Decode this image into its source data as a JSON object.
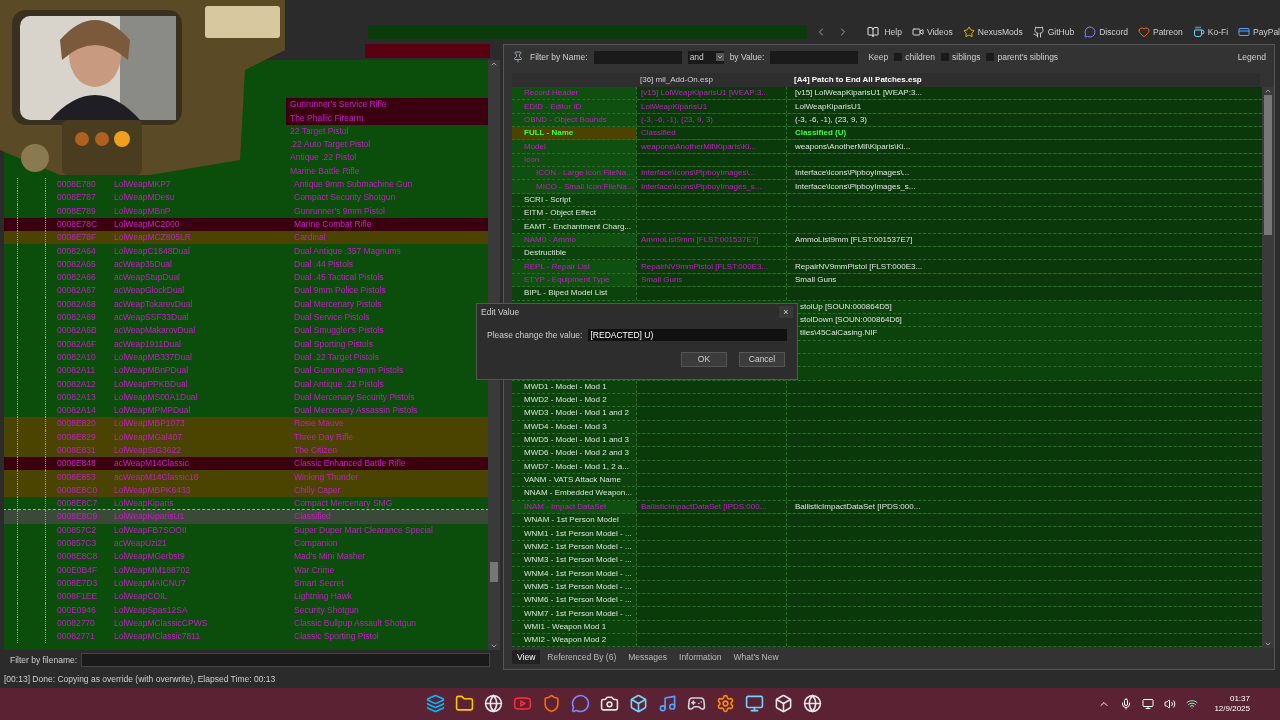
{
  "toolbar": {
    "links": [
      {
        "label": "Help",
        "kind": "book"
      },
      {
        "label": "Videos",
        "kind": "video"
      },
      {
        "label": "NexusMods",
        "kind": "nexus"
      },
      {
        "label": "GitHub",
        "kind": "github"
      },
      {
        "label": "Discord",
        "kind": "discord"
      },
      {
        "label": "Patreon",
        "kind": "patreon"
      },
      {
        "label": "Ko-Fi",
        "kind": "kofi"
      },
      {
        "label": "PayPal",
        "kind": "paypal"
      }
    ]
  },
  "left_pane": {
    "rows": [
      {
        "name": "Gunrunner's Service Rifle",
        "color": "#3a0010",
        "selected": false
      },
      {
        "name": "The Phallic Firearm",
        "color": "#3a0010",
        "selected": false
      },
      {
        "name": "22 Target Pistol",
        "color": "#0b4d0b",
        "selected": false
      },
      {
        "name": ".22 Auto Target Pistol",
        "color": "#0b4d0b",
        "selected": false
      },
      {
        "name": "Antique .22 Pistol",
        "color": "#0b4d0b",
        "selected": false
      },
      {
        "name": "Marine Battle Rifle",
        "color": "#0b4d0b",
        "selected": false
      },
      {
        "form_id": "0008E780",
        "editor_id": "LolWeapMKP7",
        "name": "Antique 9mm Submachine Gun",
        "color": "#0b4d0b",
        "selected": false
      },
      {
        "form_id": "0008E787",
        "editor_id": "LolWeapMDesu",
        "name": "Compact Security Shotgun",
        "color": "#0b4d0b",
        "selected": false
      },
      {
        "form_id": "0008E789",
        "editor_id": "LolWeapMBnP",
        "name": "Gunrunner's 9mm Pistol",
        "color": "#0b4d0b",
        "selected": false
      },
      {
        "form_id": "0008E78C",
        "editor_id": "LolWeapMC2000",
        "name": "Marine Combat Rifle",
        "color": "#3a0010",
        "selected": false
      },
      {
        "form_id": "0008E78F",
        "editor_id": "LolWeapMCZ805LR",
        "name": "Cardinal",
        "color": "#4a4400",
        "selected": false
      },
      {
        "form_id": "00082A64",
        "editor_id": "LolWeapC1848Dual",
        "name": "Dual Antique .357 Magnums",
        "color": "#0b4d0b",
        "selected": false
      },
      {
        "form_id": "00082A65",
        "editor_id": "acWeap35Dual",
        "name": "Dual .44 Pistols",
        "color": "#0b4d0b",
        "selected": false
      },
      {
        "form_id": "00082A66",
        "editor_id": "acWeapStupDual",
        "name": "Dual .45 Tactical Pistols",
        "color": "#0b4d0b",
        "selected": false
      },
      {
        "form_id": "00082A67",
        "editor_id": "acWeapGlockDual",
        "name": "Dual 9mm Police Pistols",
        "color": "#0b4d0b",
        "selected": false
      },
      {
        "form_id": "00082A68",
        "editor_id": "acWeapTokarevDual",
        "name": "Dual Mercenary Pistols",
        "color": "#0b4d0b",
        "selected": false
      },
      {
        "form_id": "00082A69",
        "editor_id": "acWeapSSF33Dual",
        "name": "Dual Service Pistols",
        "color": "#0b4d0b",
        "selected": false
      },
      {
        "form_id": "00082A6B",
        "editor_id": "acWeapMakarovDual",
        "name": "Dual Smuggler's Pistols",
        "color": "#0b4d0b",
        "selected": false
      },
      {
        "form_id": "00082A6F",
        "editor_id": "acWeap1911Dual",
        "name": "Dual Sporting Pistols",
        "color": "#0b4d0b",
        "selected": false
      },
      {
        "form_id": "00082A10",
        "editor_id": "LolWeapMB337Dual",
        "name": "Dual .22 Target Pistols",
        "color": "#0b4d0b",
        "selected": false
      },
      {
        "form_id": "00082A11",
        "editor_id": "LolWeapMBnPDual",
        "name": "Dual Gunrunner 9mm Pistols",
        "color": "#0b4d0b",
        "selected": false
      },
      {
        "form_id": "00082A12",
        "editor_id": "LolWeapPPKBDual",
        "name": "Dual Antique .22 Pistols",
        "color": "#0b4d0b",
        "selected": false
      },
      {
        "form_id": "00082A13",
        "editor_id": "LolWeapMS00A1Dual",
        "name": "Dual Mercenary Security Pistols",
        "color": "#0b4d0b",
        "selected": false
      },
      {
        "form_id": "00082A14",
        "editor_id": "LolWeapMPMPDual",
        "name": "Dual Mercenary Assassin Pistols",
        "color": "#0b4d0b",
        "selected": false
      },
      {
        "form_id": "0008E820",
        "editor_id": "LolWeapMBP1073",
        "name": "Rosie Mauve",
        "color": "#4a4400",
        "selected": false
      },
      {
        "form_id": "0008E829",
        "editor_id": "LolWeapMGal407",
        "name": "Three Day Rifle",
        "color": "#4a4400",
        "selected": false
      },
      {
        "form_id": "0008E831",
        "editor_id": "LolWeapSIG3622",
        "name": "The Citizen",
        "color": "#4a4400",
        "selected": false
      },
      {
        "form_id": "0008E848",
        "editor_id": "acWeapM14Classic",
        "name": "Classic Enhanced Battle Rifle",
        "color": "#3a0010",
        "selected": false
      },
      {
        "form_id": "0008E853",
        "editor_id": "acWeapM14Classic18",
        "name": "Winking Thunder",
        "color": "#4a4400",
        "selected": false
      },
      {
        "form_id": "0008E8C0",
        "editor_id": "LolWeapMBPK6433",
        "name": "Chilly Caper",
        "color": "#4a4400",
        "selected": false
      },
      {
        "form_id": "0008E8C7",
        "editor_id": "LolWeapKiparis",
        "name": "Compact Mercenary SMG",
        "color": "#0b4d0b",
        "selected": false
      },
      {
        "form_id": "0008E8C9",
        "editor_id": "LolWeapKiparisU1",
        "name": "Classified",
        "color": "#3b4a38",
        "selected": true
      },
      {
        "form_id": "000857C2",
        "editor_id": "LolWeapFB7SOOII",
        "name": "Super Duper Mart Clearance Special",
        "color": "#0b4d0b",
        "selected": false
      },
      {
        "form_id": "000857C3",
        "editor_id": "acWeapUzi21",
        "name": "Companion",
        "color": "#0b4d0b",
        "selected": false
      },
      {
        "form_id": "0008E8C8",
        "editor_id": "LolWeapMGerbst9",
        "name": "Mad's Mini Masher",
        "color": "#0b4d0b",
        "selected": false
      },
      {
        "form_id": "000E0B4F",
        "editor_id": "LolWeapMM188702",
        "name": "War Crime",
        "color": "#0b4d0b",
        "selected": false
      },
      {
        "form_id": "0008E7D3",
        "editor_id": "LolWeapMAICNU7",
        "name": "Smart Secret",
        "color": "#0b4d0b",
        "selected": false
      },
      {
        "form_id": "0008F1EE",
        "editor_id": "LolWeapCOIL",
        "name": "Lightning Hawk",
        "color": "#0b4d0b",
        "selected": false
      },
      {
        "form_id": "000E0946",
        "editor_id": "LolWeapSpas12SA",
        "name": "Security Shotgun",
        "color": "#0b4d0b",
        "selected": false
      },
      {
        "form_id": "00082770",
        "editor_id": "LolWeapMClassicCPWS",
        "name": "Classic Bullpup Assault Shotgun",
        "color": "#0b4d0b",
        "selected": false
      },
      {
        "form_id": "00082771",
        "editor_id": "LolWeapMClassic7811",
        "name": "Classic Sporting Pistol",
        "color": "#0b4d0b",
        "selected": false
      }
    ],
    "filter": {
      "label": "Filter by filename:"
    }
  },
  "right_pane": {
    "filter": {
      "name_label": "Filter by Name:",
      "operator": "and",
      "value_label": "by Value:",
      "keep_label": "Keep",
      "options": [
        {
          "label": "children",
          "checked": false
        },
        {
          "label": "siblings",
          "checked": false
        },
        {
          "label": "parent's siblings",
          "checked": false
        }
      ],
      "legend": "Legend"
    },
    "columns": [
      "[36] mil_Add-On.esp",
      "[A4] Patch to End All Patches.esp"
    ],
    "rows_above": [
      {
        "label": "Record Header",
        "values": [
          "[v15] LolWeapKiparisU1 [WEAP:3...",
          "[v15] LolWeapKiparisU1 [WEAP:3..."
        ],
        "conflict": true,
        "highlight": false
      },
      {
        "label": "EDID - Editor ID",
        "values": [
          "LolWeapKiparisU1",
          "LolWeapKiparisU1"
        ],
        "conflict": true,
        "highlight": false
      },
      {
        "label": "OBND - Object Bounds",
        "values": [
          "(-3, -6, -1), (23, 9, 3)",
          "(-3, -6, -1), (23, 9, 3)"
        ],
        "conflict": true,
        "highlight": false
      },
      {
        "label": "FULL - Name",
        "values": [
          "Classified",
          "Classified (U)"
        ],
        "conflict": true,
        "highlight": true
      },
      {
        "label": "Model",
        "values": [
          "weapons\\AnotherMil\\Kiparis\\Ki...",
          "weapons\\AnotherMil\\Kiparis\\Ki..."
        ],
        "conflict": true,
        "highlight": false
      },
      {
        "label": "Icon",
        "conflict": true,
        "highlight": false,
        "children": [
          {
            "label": "ICON - Large Icon FileNa...",
            "values": [
              "Interface\\Icons\\PipboyImages\\...",
              "Interface\\Icons\\PipboyImages\\..."
            ],
            "conflict": true,
            "highlight": false
          },
          {
            "label": "MICO - Small Icon FileNa...",
            "values": [
              "Interface\\Icons\\PipboyImages_s...",
              "Interface\\Icons\\PipboyImages_s..."
            ],
            "conflict": true,
            "highlight": false
          }
        ]
      },
      {
        "label": "SCRI - Script",
        "conflict": false,
        "highlight": false
      },
      {
        "label": "EITM - Object Effect",
        "conflict": false,
        "highlight": false
      },
      {
        "label": "EAMT - Enchantment Charg...",
        "conflict": false,
        "highlight": false
      },
      {
        "label": "NAM0 - Ammo",
        "values": [
          "AmmoList9mm [FLST:001537E7]",
          "AmmoList9mm [FLST:001537E7]"
        ],
        "conflict": true,
        "highlight": false
      },
      {
        "label": "Destructible",
        "conflict": false,
        "highlight": false
      },
      {
        "label": "REPL - Repair List",
        "values": [
          "RepairNV9mmPistol [FLST:000E3...",
          "RepairNV9mmPistol [FLST:000E3..."
        ],
        "conflict": true,
        "highlight": false
      },
      {
        "label": "ETYP - Equipment Type",
        "values": [
          "Small Guns",
          "Small Guns"
        ],
        "conflict": true,
        "highlight": false
      },
      {
        "label": "BIPL - Biped Model List",
        "conflict": false,
        "highlight": false
      }
    ],
    "partial_values": [
      "stolUp [SOUN:000864D5]",
      "stolDown [SOUN:000864D6]",
      "tiles\\45CalCasing.NIF"
    ],
    "rows_below": [
      {
        "label": "MWD1 - Model - Mod 1",
        "conflict": false,
        "highlight": false
      },
      {
        "label": "MWD2 - Model - Mod 2",
        "conflict": false,
        "highlight": false
      },
      {
        "label": "MWD3 - Model - Mod 1 and 2",
        "conflict": false,
        "highlight": false
      },
      {
        "label": "MWD4 - Model - Mod 3",
        "conflict": false,
        "highlight": false
      },
      {
        "label": "MWD5 - Model - Mod 1 and 3",
        "conflict": false,
        "highlight": false
      },
      {
        "label": "MWD6 - Model - Mod 2 and 3",
        "conflict": false,
        "highlight": false
      },
      {
        "label": "MWD7 - Model - Mod 1, 2 a...",
        "conflict": false,
        "highlight": false
      },
      {
        "label": "VANM - VATS Attack Name",
        "conflict": false,
        "highlight": false
      },
      {
        "label": "NNAM - Embedded Weapon...",
        "conflict": false,
        "highlight": false
      },
      {
        "label": "INAM - Impact DataSet",
        "values": [
          "BallisticImpactDataSet [IPDS:000...",
          "BallisticImpactDataSet [IPDS:000..."
        ],
        "conflict": true,
        "highlight": false
      },
      {
        "label": "WNAM - 1st Person Model",
        "conflict": false,
        "highlight": false
      },
      {
        "label": "WNM1 - 1st Person Model - ...",
        "conflict": false,
        "highlight": false
      },
      {
        "label": "WNM2 - 1st Person Model - ...",
        "conflict": false,
        "highlight": false
      },
      {
        "label": "WNM3 - 1st Person Model - ...",
        "conflict": false,
        "highlight": false
      },
      {
        "label": "WNM4 - 1st Person Model - ...",
        "conflict": false,
        "highlight": false
      },
      {
        "label": "WNM5 - 1st Person Model - ...",
        "conflict": false,
        "highlight": false
      },
      {
        "label": "WNM6 - 1st Person Model - ...",
        "conflict": false,
        "highlight": false
      },
      {
        "label": "WNM7 - 1st Person Model - ...",
        "conflict": false,
        "highlight": false
      },
      {
        "label": "WMI1 - Weapon Mod 1",
        "conflict": false,
        "highlight": false
      },
      {
        "label": "WMI2 - Weapon Mod 2",
        "conflict": false,
        "highlight": false
      }
    ],
    "tabs": [
      {
        "label": "View",
        "selected": true
      },
      {
        "label": "Referenced By (6)",
        "selected": false
      },
      {
        "label": "Messages",
        "selected": false
      },
      {
        "label": "Information",
        "selected": false
      },
      {
        "label": "What's New",
        "selected": false
      }
    ]
  },
  "dialog": {
    "title": "Edit Value",
    "close": "×",
    "prompt": "Please change the value:",
    "value": "[REDACTED] U)",
    "buttons": [
      "OK",
      "Cancel"
    ]
  },
  "status_bar": {
    "message": "[00:13] Done: Copying as override (with overwrite), Elapsed Time: 00:13"
  },
  "taskbar": {
    "time": "01:37",
    "date": "12/9/2025"
  }
}
